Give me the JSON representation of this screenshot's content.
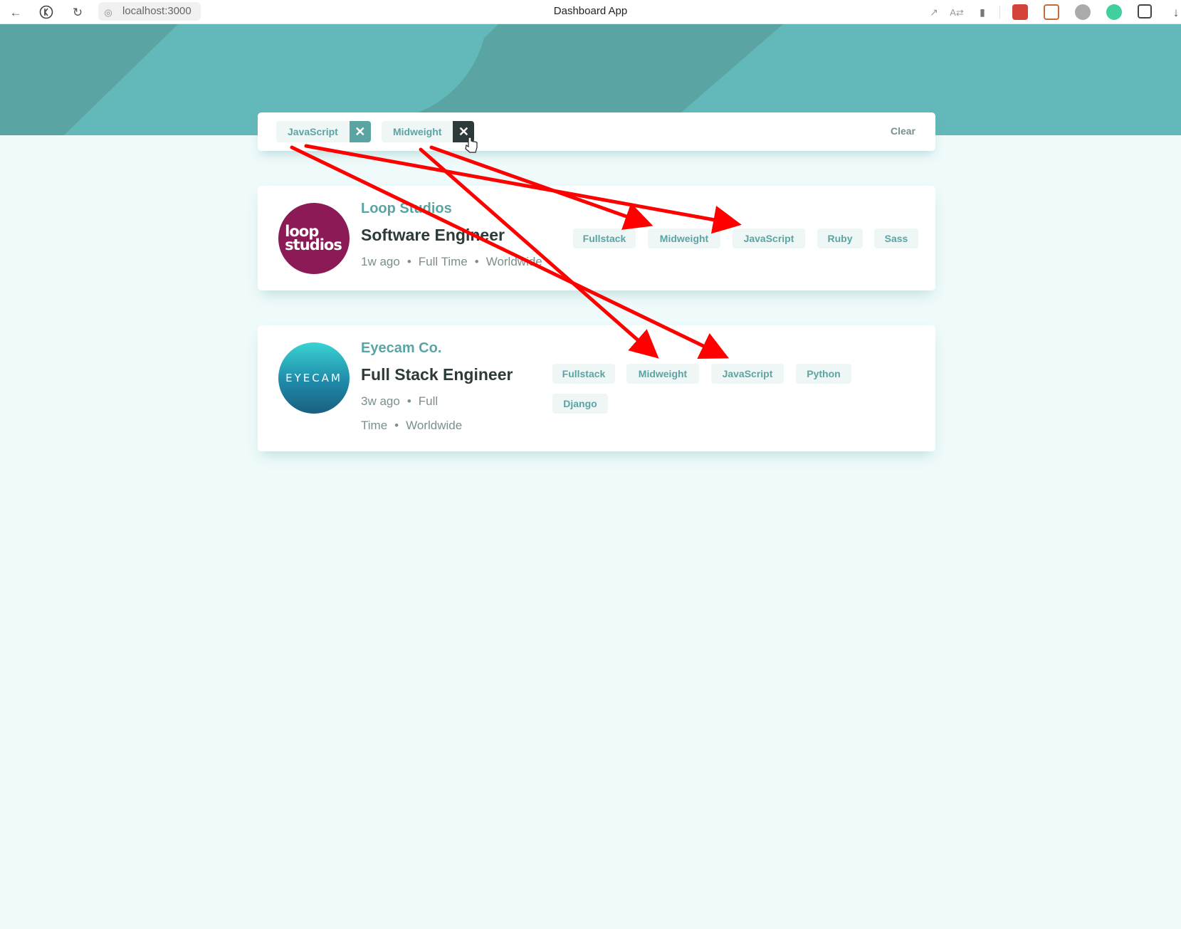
{
  "browser": {
    "url": "localhost:3000",
    "title": "Dashboard App"
  },
  "filters": {
    "items": [
      "JavaScript",
      "Midweight"
    ],
    "clear_label": "Clear"
  },
  "jobs": [
    {
      "logo_text": "loop\nstudios",
      "company": "Loop Studios",
      "position": "Software Engineer",
      "posted": "1w ago",
      "contract": "Full Time",
      "location": "Worldwide",
      "tags": [
        "Fullstack",
        "Midweight",
        "JavaScript",
        "Ruby",
        "Sass"
      ]
    },
    {
      "logo_text": "EYECAM",
      "company": "Eyecam Co.",
      "position": "Full Stack Engineer",
      "posted": "3w ago",
      "contract": "Full Time",
      "location": "Worldwide",
      "tags": [
        "Fullstack",
        "Midweight",
        "JavaScript",
        "Python",
        "Django"
      ]
    }
  ],
  "colors": {
    "primary": "#5ba4a4",
    "background": "#effafa",
    "tag_bg": "#eef6f6",
    "dark": "#2c3a3a",
    "annotation": "#ff0000"
  },
  "icons": [
    "back-arrow-icon",
    "yandex-icon",
    "reload-icon",
    "site-info-icon",
    "share-icon",
    "translate-icon",
    "bookmark-icon",
    "download-icon",
    "close-icon"
  ]
}
